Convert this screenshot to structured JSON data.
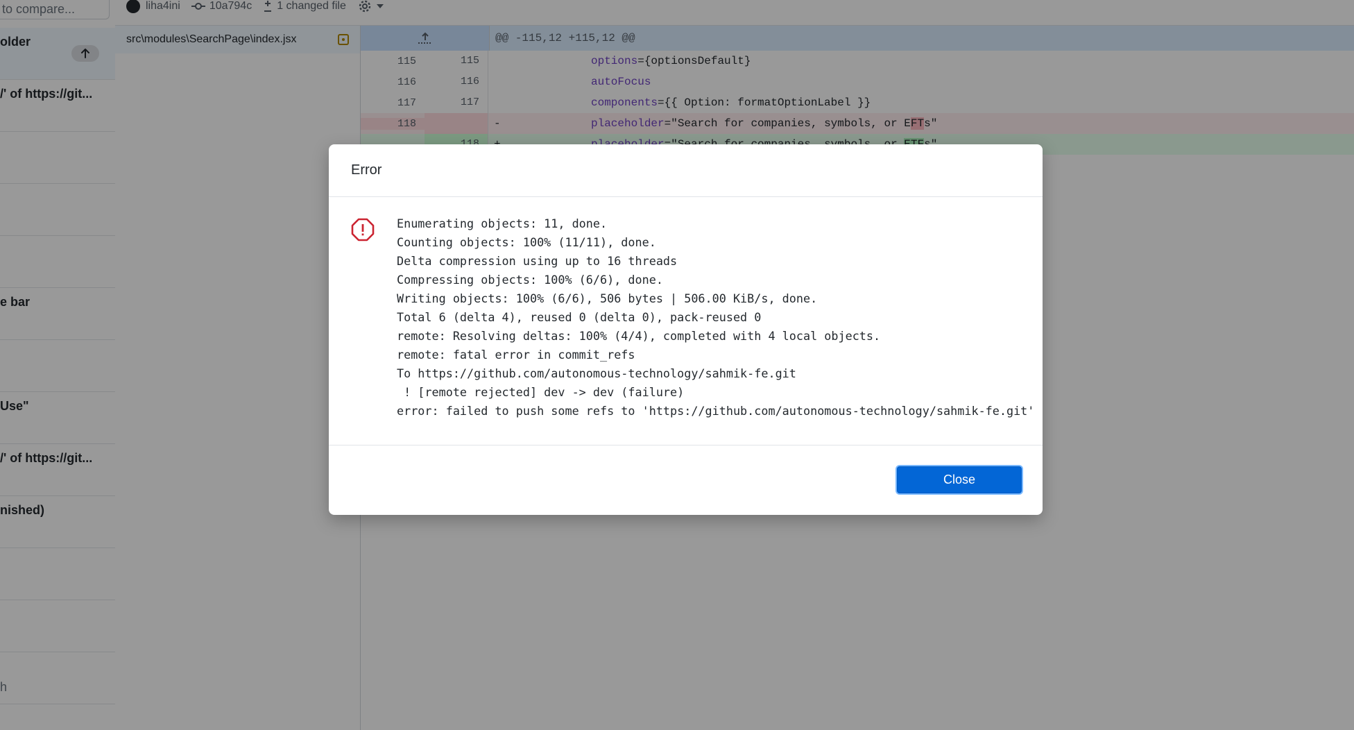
{
  "sidebar": {
    "compare_placeholder": "to compare...",
    "items": [
      {
        "title": "older",
        "selected": true
      },
      {
        "title": "/' of https://git..."
      },
      {
        "title": ""
      },
      {
        "title": ""
      },
      {
        "title": ""
      },
      {
        "title": "e bar"
      },
      {
        "title": ""
      },
      {
        "title": " Use\""
      },
      {
        "title": "/' of https://git..."
      },
      {
        "title": "nished)"
      },
      {
        "title": ""
      },
      {
        "title": ""
      },
      {
        "title": "h"
      }
    ]
  },
  "meta": {
    "author": "liha4ini",
    "commit_sha": "10a794c",
    "changed_files": "1 changed file"
  },
  "files": [
    {
      "path": "src\\modules\\SearchPage\\index.jsx",
      "status": "modified"
    }
  ],
  "diff": {
    "hunk_header": "@@ -115,12 +115,12 @@",
    "lines": {
      "l1": {
        "old": "115",
        "new": "115",
        "sign": "",
        "attr": "options",
        "rest": "={optionsDefault}"
      },
      "l2": {
        "old": "116",
        "new": "116",
        "sign": "",
        "attr": "autoFocus",
        "rest": ""
      },
      "l3": {
        "old": "117",
        "new": "117",
        "sign": "",
        "attr": "components",
        "rest": "={{ Option: formatOptionLabel }}"
      },
      "l4": {
        "old": "118",
        "new": "",
        "sign": "-",
        "attr": "placeholder",
        "pre": "=\"Search for companies, symbols, or E",
        "hl": "FT",
        "post": "s\""
      },
      "l5": {
        "old": "",
        "new": "118",
        "sign": "+",
        "attr": "placeholder",
        "pre": "=\"Search for companies, symbols, or ",
        "hl": "ETF",
        "post": "s\""
      }
    }
  },
  "dialog": {
    "title": "Error",
    "icon": "stop-icon",
    "output": "Enumerating objects: 11, done.\nCounting objects: 100% (11/11), done.\nDelta compression using up to 16 threads\nCompressing objects: 100% (6/6), done.\nWriting objects: 100% (6/6), 506 bytes | 506.00 KiB/s, done.\nTotal 6 (delta 4), reused 0 (delta 0), pack-reused 0\nremote: Resolving deltas: 100% (4/4), completed with 4 local objects.\nremote: fatal error in commit_refs\nTo https://github.com/autonomous-technology/sahmik-fe.git\n ! [remote rejected] dev -> dev (failure)\nerror: failed to push some refs to 'https://github.com/autonomous-technology/sahmik-fe.git'",
    "close_label": "Close"
  },
  "colors": {
    "accent": "#0366d6",
    "error": "#cb2431",
    "deleted_bg": "#ffeef0",
    "added_bg": "#e6ffed"
  }
}
